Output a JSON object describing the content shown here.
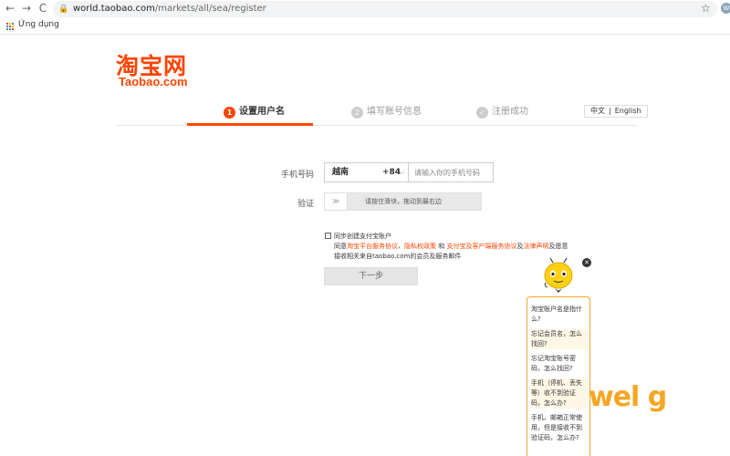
{
  "browser": {
    "back": "←",
    "forward": "→",
    "reload": "C",
    "lock": "🔒",
    "url_host": "world.taobao.com",
    "url_path": "/markets/all/sea/register",
    "star": "☆",
    "profile_initial": "W",
    "bookmarks_label": "Ứng dụng"
  },
  "logo": {
    "cn": "淘宝网",
    "en": "Taobao.com"
  },
  "steps": [
    {
      "num": "1",
      "label": "设置用户名"
    },
    {
      "num": "2",
      "label": "填写账号信息"
    },
    {
      "num": "✓",
      "label": "注册成功"
    }
  ],
  "lang": {
    "zh": "中文",
    "sep": "|",
    "en": "English"
  },
  "form": {
    "phone_label": "手机号码",
    "country_name": "越南",
    "country_code": "+84",
    "caret": "⌵",
    "phone_placeholder": "请输入你的手机号码",
    "verify_label": "验证",
    "slider_handle": "≫",
    "slider_hint": "请按住滑块，拖动到最右边"
  },
  "agreement": {
    "line1": "同步创建支付宝账户",
    "prefix": "同意",
    "link1": "淘宝平台服务协议",
    "sep1": "、",
    "link2": "隐私权政策",
    "and": " 和 ",
    "link3": "支付宝及客户端服务协议",
    "sep2": "及",
    "link4": "法律声明",
    "suffix": "及愿意",
    "line3": "接收相关来自taobao.com的会员及服务邮件"
  },
  "next_button": "下一步",
  "helper": {
    "close": "✕",
    "faqs": [
      "淘宝账户名是指什么?",
      "忘记会员名，怎么找回?",
      "忘记淘宝账号密码，怎么找回?",
      "手机（停机、丢失等）收不到验证码，怎么办?",
      "手机、邮箱正常使用，但是接收不到验证码，怎么办?"
    ]
  },
  "watermark": "wel g",
  "colors": {
    "accent": "#ff4400",
    "helper_border": "#f5a623"
  }
}
